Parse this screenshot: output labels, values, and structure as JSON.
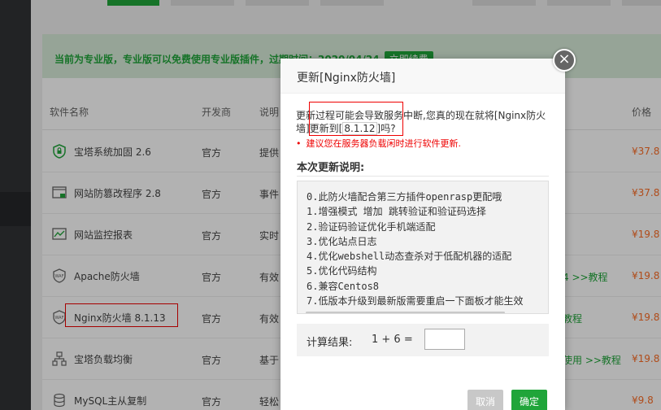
{
  "notice": {
    "text": "当前为专业版，专业版可以免费使用专业版插件，过期时间：2020/04/24",
    "renew_label": "立即续费"
  },
  "table": {
    "headers": {
      "name": "软件名称",
      "developer": "开发商",
      "description": "说明",
      "price": "价格"
    },
    "rows": [
      {
        "icon": "shield-icon",
        "name": "宝塔系统加固 2.6",
        "developer": "官方",
        "description": "提供",
        "extra": "",
        "price": "¥37.8"
      },
      {
        "icon": "browser-lock-icon",
        "name": "网站防篡改程序 2.8",
        "developer": "官方",
        "description": "事件",
        "extra": "",
        "price": "¥37.8"
      },
      {
        "icon": "line-chart-icon",
        "name": "网站监控报表",
        "developer": "官方",
        "description": "实时",
        "extra": "",
        "price": "¥19.8"
      },
      {
        "icon": "waf-shield-icon",
        "name": "Apache防火墙",
        "developer": "官方",
        "description": "有效",
        "extra": "4 >>教程",
        "price": "¥19.8"
      },
      {
        "icon": "waf-shield-icon",
        "name": "Nginx防火墙 8.1.13",
        "developer": "官方",
        "description": "有效",
        "extra": "教程",
        "price": "¥19.8"
      },
      {
        "icon": "load-balance-icon",
        "name": "宝塔负载均衡",
        "developer": "官方",
        "description": "基于",
        "extra": "使用 >>教程",
        "price": "¥19.8"
      },
      {
        "icon": "database-icon",
        "name": "MySQL主从复制",
        "developer": "官方",
        "description": "轻松",
        "extra": "",
        "price": "¥9.8"
      }
    ]
  },
  "modal": {
    "title": "更新[Nginx防火墙]",
    "confirm_prefix": "更新过程可能会导致服务中断,您真的现在就将[Nginx防火墙]更新到[",
    "confirm_version": "8.1.12",
    "confirm_suffix": "]吗?",
    "warning": "建议您在服务器负载闲时进行软件更新.",
    "notes_title": "本次更新说明:",
    "notes": [
      "0.此防火墙配合第三方插件openrasp更配哦",
      "1.增强模式 增加 跳转验证和验证码选择",
      "2.验证码验证优化手机端适配",
      "3.优化站点日志",
      "4.优化webshell动态查杀对于低配机器的适配",
      "5.优化代码结构",
      "6.兼容Centos8",
      "7.低版本升级到最新版需要重启一下面板才能生效"
    ],
    "calc_label": "计算结果:",
    "calc_expr": "1 + 6  =",
    "calc_value": "",
    "cancel_label": "取消",
    "ok_label": "确定",
    "close_glyph": "×"
  }
}
